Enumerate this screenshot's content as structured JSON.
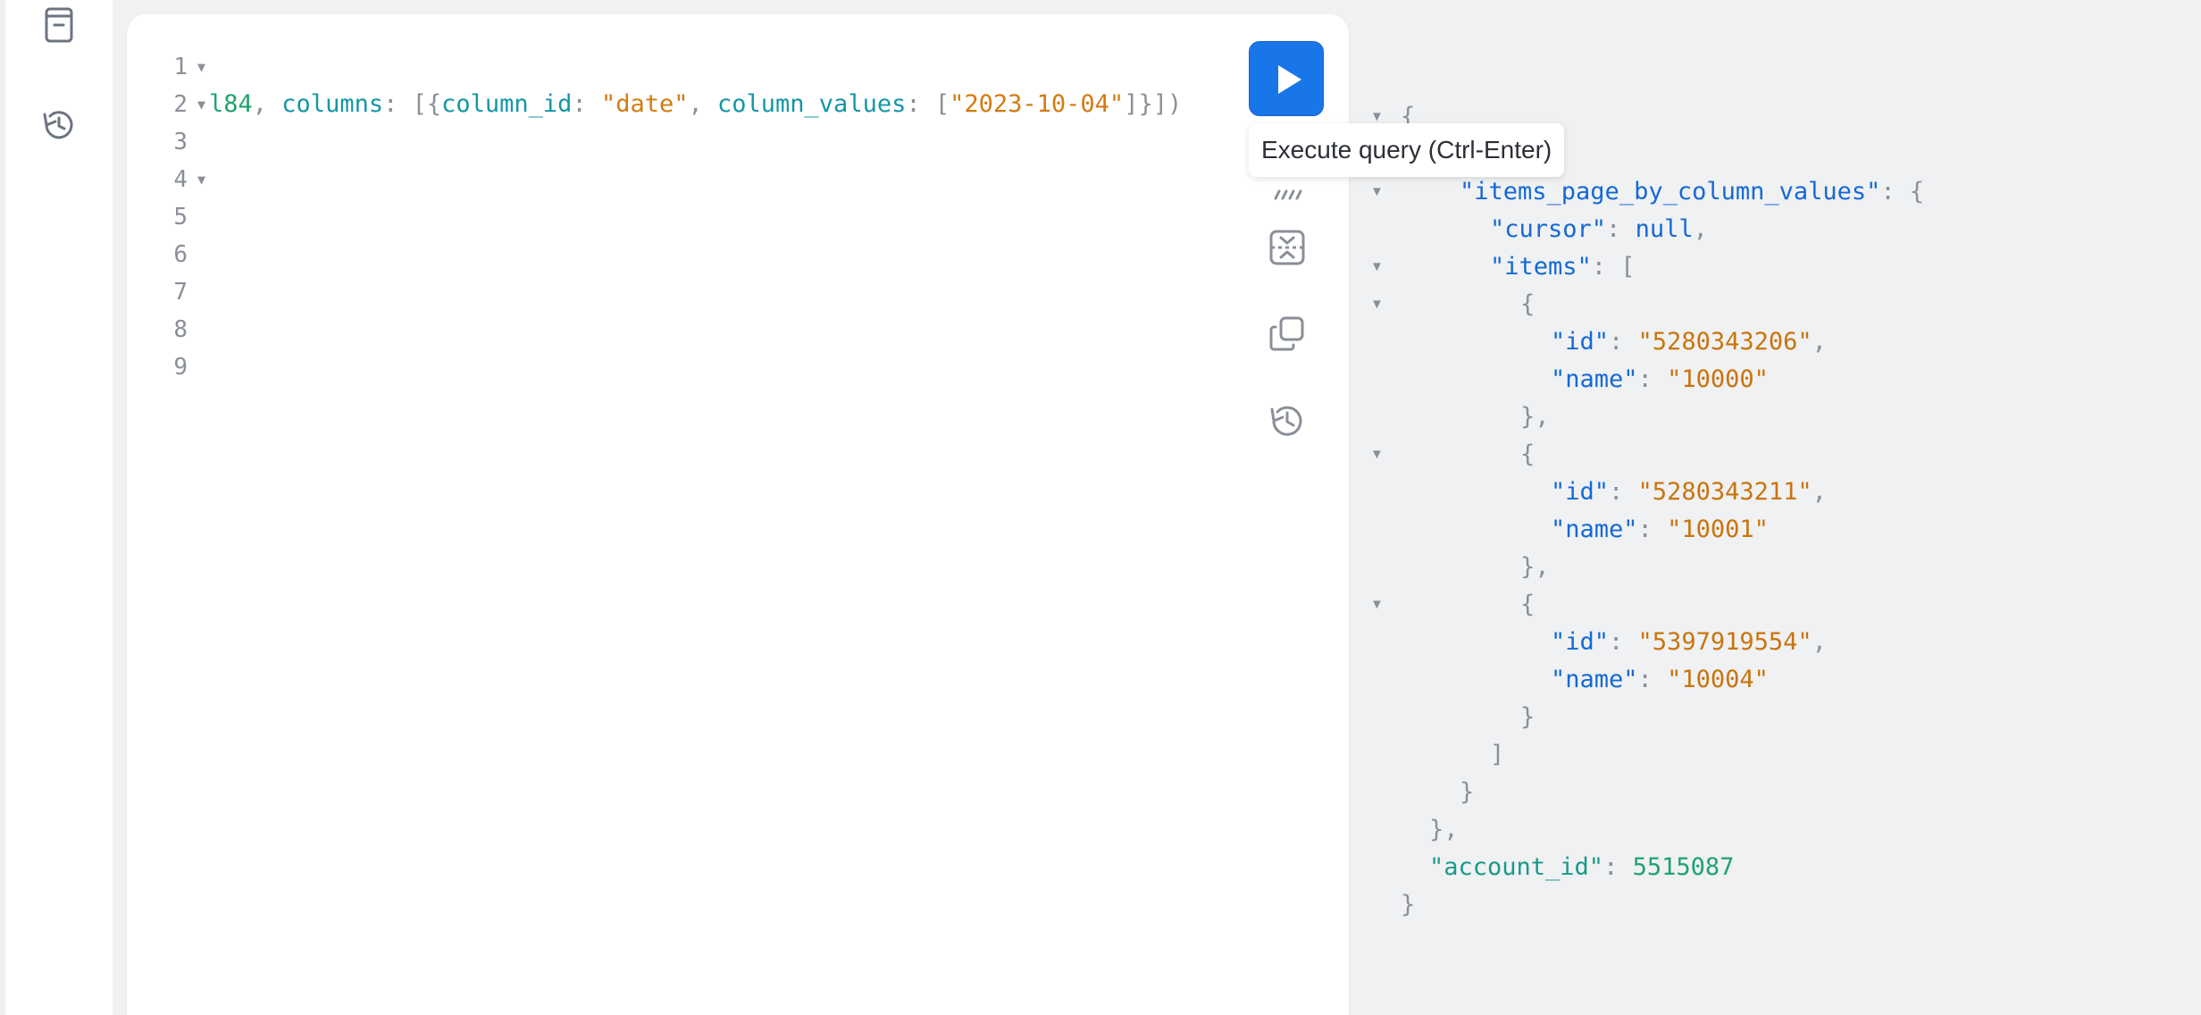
{
  "gutter": {
    "lines": [
      "1",
      "2",
      "3",
      "4",
      "5",
      "6",
      "7",
      "8",
      "9"
    ]
  },
  "editor": {
    "line2": {
      "lead": "l84",
      "p1": ", ",
      "k1": "columns",
      "p2": ": [{",
      "k2": "column_id",
      "p3": ": ",
      "s1": "\"date\"",
      "p4": ", ",
      "k3": "column_values",
      "p5": ": [",
      "s2": "\"2023-10-04\"",
      "p6": "]}])"
    }
  },
  "toolbar": {
    "run_icon": "play-icon",
    "prettify_icon": "prettify-icon",
    "merge_icon": "merge-fragments-icon",
    "copy_icon": "copy-icon",
    "history_icon": "history-icon"
  },
  "tooltip": {
    "text": "Execute query (Ctrl-Enter)"
  },
  "rail": {
    "docs_icon": "docs-icon",
    "history_icon": "history-icon"
  },
  "result": {
    "open_brace": "{",
    "k_items_page": "\"items_page_by_column_values\"",
    "colon_brace": ": {",
    "k_cursor": "\"cursor\"",
    "colon": ": ",
    "v_cursor": "null",
    "comma": ",",
    "k_items": "\"items\"",
    "colon_bracket": ": [",
    "items": [
      {
        "id_key": "\"id\"",
        "id": "\"5280343206\"",
        "name_key": "\"name\"",
        "name": "\"10000\""
      },
      {
        "id_key": "\"id\"",
        "id": "\"5280343211\"",
        "name_key": "\"name\"",
        "name": "\"10001\""
      },
      {
        "id_key": "\"id\"",
        "id": "\"5397919554\"",
        "name_key": "\"name\"",
        "name": "\"10004\""
      }
    ],
    "obj_open": "{",
    "obj_close_comma": "},",
    "obj_close": "}",
    "arr_close": "]",
    "close_brace": "}",
    "close_brace_comma": "},",
    "k_account": "\"account_id\"",
    "v_account": "5515087"
  },
  "colors": {
    "accent": "#1976e8",
    "json_key": "#1469d4",
    "json_string": "#c9740c",
    "json_number": "#1fa36e"
  }
}
